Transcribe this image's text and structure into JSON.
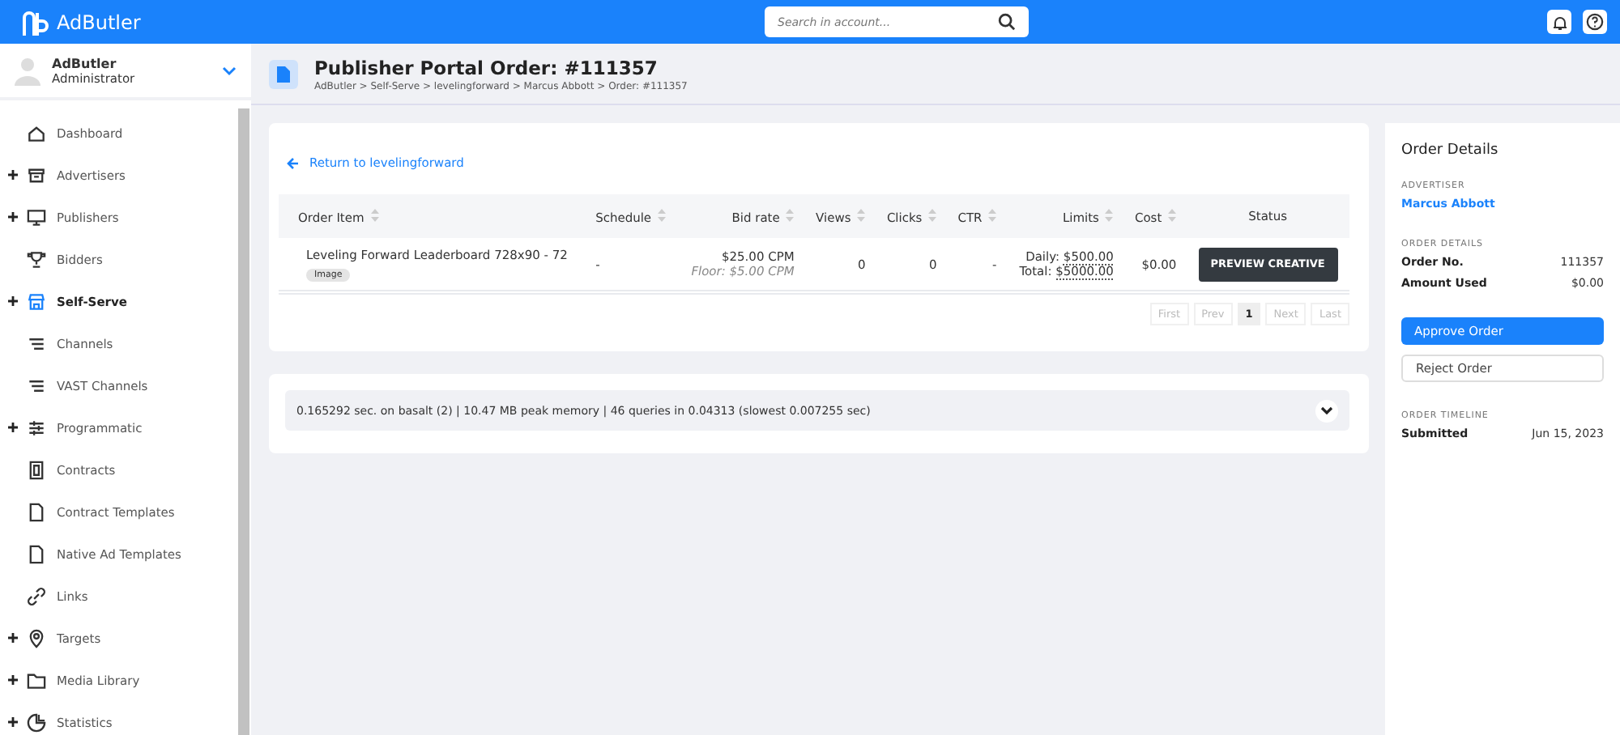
{
  "topbar": {
    "logo": "AdButler",
    "search": {
      "placeholder": "Search in account..."
    }
  },
  "user": {
    "name": "AdButler",
    "role": "Administrator"
  },
  "sidebar": {
    "items": [
      {
        "label": "Dashboard",
        "expandable": false,
        "selected": false
      },
      {
        "label": "Advertisers",
        "expandable": true,
        "selected": false
      },
      {
        "label": "Publishers",
        "expandable": true,
        "selected": false
      },
      {
        "label": "Bidders",
        "expandable": false,
        "selected": false
      },
      {
        "label": "Self-Serve",
        "expandable": true,
        "selected": true
      },
      {
        "label": "Channels",
        "expandable": false,
        "selected": false
      },
      {
        "label": "VAST Channels",
        "expandable": false,
        "selected": false
      },
      {
        "label": "Programmatic",
        "expandable": true,
        "selected": false
      },
      {
        "label": "Contracts",
        "expandable": false,
        "selected": false
      },
      {
        "label": "Contract Templates",
        "expandable": false,
        "selected": false
      },
      {
        "label": "Native Ad Templates",
        "expandable": false,
        "selected": false
      },
      {
        "label": "Links",
        "expandable": false,
        "selected": false
      },
      {
        "label": "Targets",
        "expandable": true,
        "selected": false
      },
      {
        "label": "Media Library",
        "expandable": true,
        "selected": false
      },
      {
        "label": "Statistics",
        "expandable": true,
        "selected": false
      }
    ]
  },
  "page": {
    "title": "Publisher Portal Order: #111357",
    "breadcrumbs": "AdButler > Self-Serve > levelingforward > Marcus Abbott > Order: #111357"
  },
  "back_link": "Return to levelingforward",
  "table": {
    "columns": [
      {
        "label": "Order Item",
        "sortable": true
      },
      {
        "label": "Schedule",
        "sortable": true
      },
      {
        "label": "Bid rate",
        "sortable": true
      },
      {
        "label": "Views",
        "sortable": true
      },
      {
        "label": "Clicks",
        "sortable": true
      },
      {
        "label": "CTR",
        "sortable": true
      },
      {
        "label": "Limits",
        "sortable": true
      },
      {
        "label": "Cost",
        "sortable": true
      },
      {
        "label": "Status",
        "sortable": false
      }
    ],
    "rows": [
      {
        "item": "Leveling Forward Leaderboard 728x90 - 72",
        "tag": "Image",
        "schedule": "-",
        "bid": "$25.00 CPM",
        "floor": "Floor: $5.00 CPM",
        "views": "0",
        "clicks": "0",
        "ctr": "-",
        "daily_label": "Daily:",
        "daily": "$500.00",
        "total_label": "Total:",
        "total": "$5000.00",
        "cost": "$0.00",
        "action": "PREVIEW CREATIVE"
      }
    ]
  },
  "pagination": [
    {
      "label": "First",
      "selected": false,
      "disabled": true
    },
    {
      "label": "Prev",
      "selected": false,
      "disabled": true
    },
    {
      "label": "1",
      "selected": true,
      "disabled": false
    },
    {
      "label": "Next",
      "selected": false,
      "disabled": true
    },
    {
      "label": "Last",
      "selected": false,
      "disabled": true
    }
  ],
  "debug_bar": "0.165292 sec. on basalt (2) | 10.47 MB peak memory | 46 queries in 0.04313 (slowest 0.007255 sec)",
  "order_details": {
    "title": "Order Details",
    "advertiser_heading": "ADVERTISER",
    "advertiser": "Marcus Abbott",
    "details_heading": "ORDER DETAILS",
    "fields": [
      {
        "label": "Order No.",
        "value": "111357"
      },
      {
        "label": "Amount Used",
        "value": "$0.00"
      }
    ],
    "approve": "Approve Order",
    "reject": "Reject Order",
    "timeline_heading": "ORDER TIMELINE",
    "timeline": [
      {
        "label": "Submitted",
        "value": "Jun 15, 2023"
      }
    ]
  }
}
